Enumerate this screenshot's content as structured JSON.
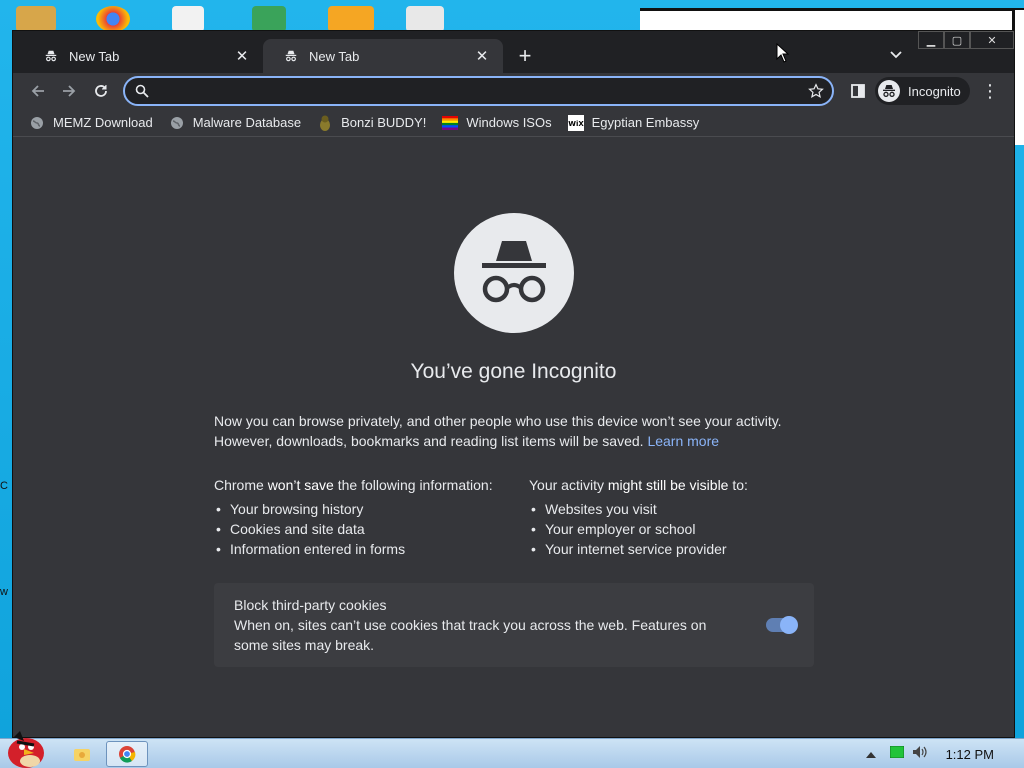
{
  "tabs": [
    {
      "title": "New Tab",
      "active": false
    },
    {
      "title": "New Tab",
      "active": true
    }
  ],
  "toolbar": {
    "omnibox_value": "",
    "profile_label": "Incognito"
  },
  "bookmarks": [
    {
      "label": "MEMZ Download",
      "icon": "globe-icon"
    },
    {
      "label": "Malware Database",
      "icon": "globe-icon"
    },
    {
      "label": "Bonzi BUDDY!",
      "icon": "bonzi-icon"
    },
    {
      "label": "Windows ISOs",
      "icon": "rainbow-flag-icon"
    },
    {
      "label": "Egyptian Embassy",
      "icon": "wix-icon"
    }
  ],
  "page": {
    "heading": "You’ve gone Incognito",
    "intro": "Now you can browse privately, and other people who use this device won’t see your activity. However, downloads, bookmarks and reading list items will be saved.",
    "learn_more": "Learn more",
    "wont_save": {
      "heading_pre": "Chrome ",
      "heading_bold": "won’t save",
      "heading_post": " the following information:",
      "items": [
        "Your browsing history",
        "Cookies and site data",
        "Information entered in forms"
      ]
    },
    "visible_to": {
      "heading_pre": "Your activity ",
      "heading_bold": "might still be visible",
      "heading_post": " to:",
      "items": [
        "Websites you visit",
        "Your employer or school",
        "Your internet service provider"
      ]
    },
    "cookies": {
      "title": "Block third-party cookies",
      "description": "When on, sites can’t use cookies that track you across the web. Features on some sites may break.",
      "enabled": true
    }
  },
  "desktop": {
    "edge_labels": [
      "C",
      "w"
    ]
  },
  "taskbar": {
    "clock": "1:12 PM"
  },
  "colors": {
    "accent": "#8ab4f8",
    "page_bg": "#35363a",
    "tabstrip_bg": "#202124",
    "desktop_bg": "#1aa9e0"
  }
}
